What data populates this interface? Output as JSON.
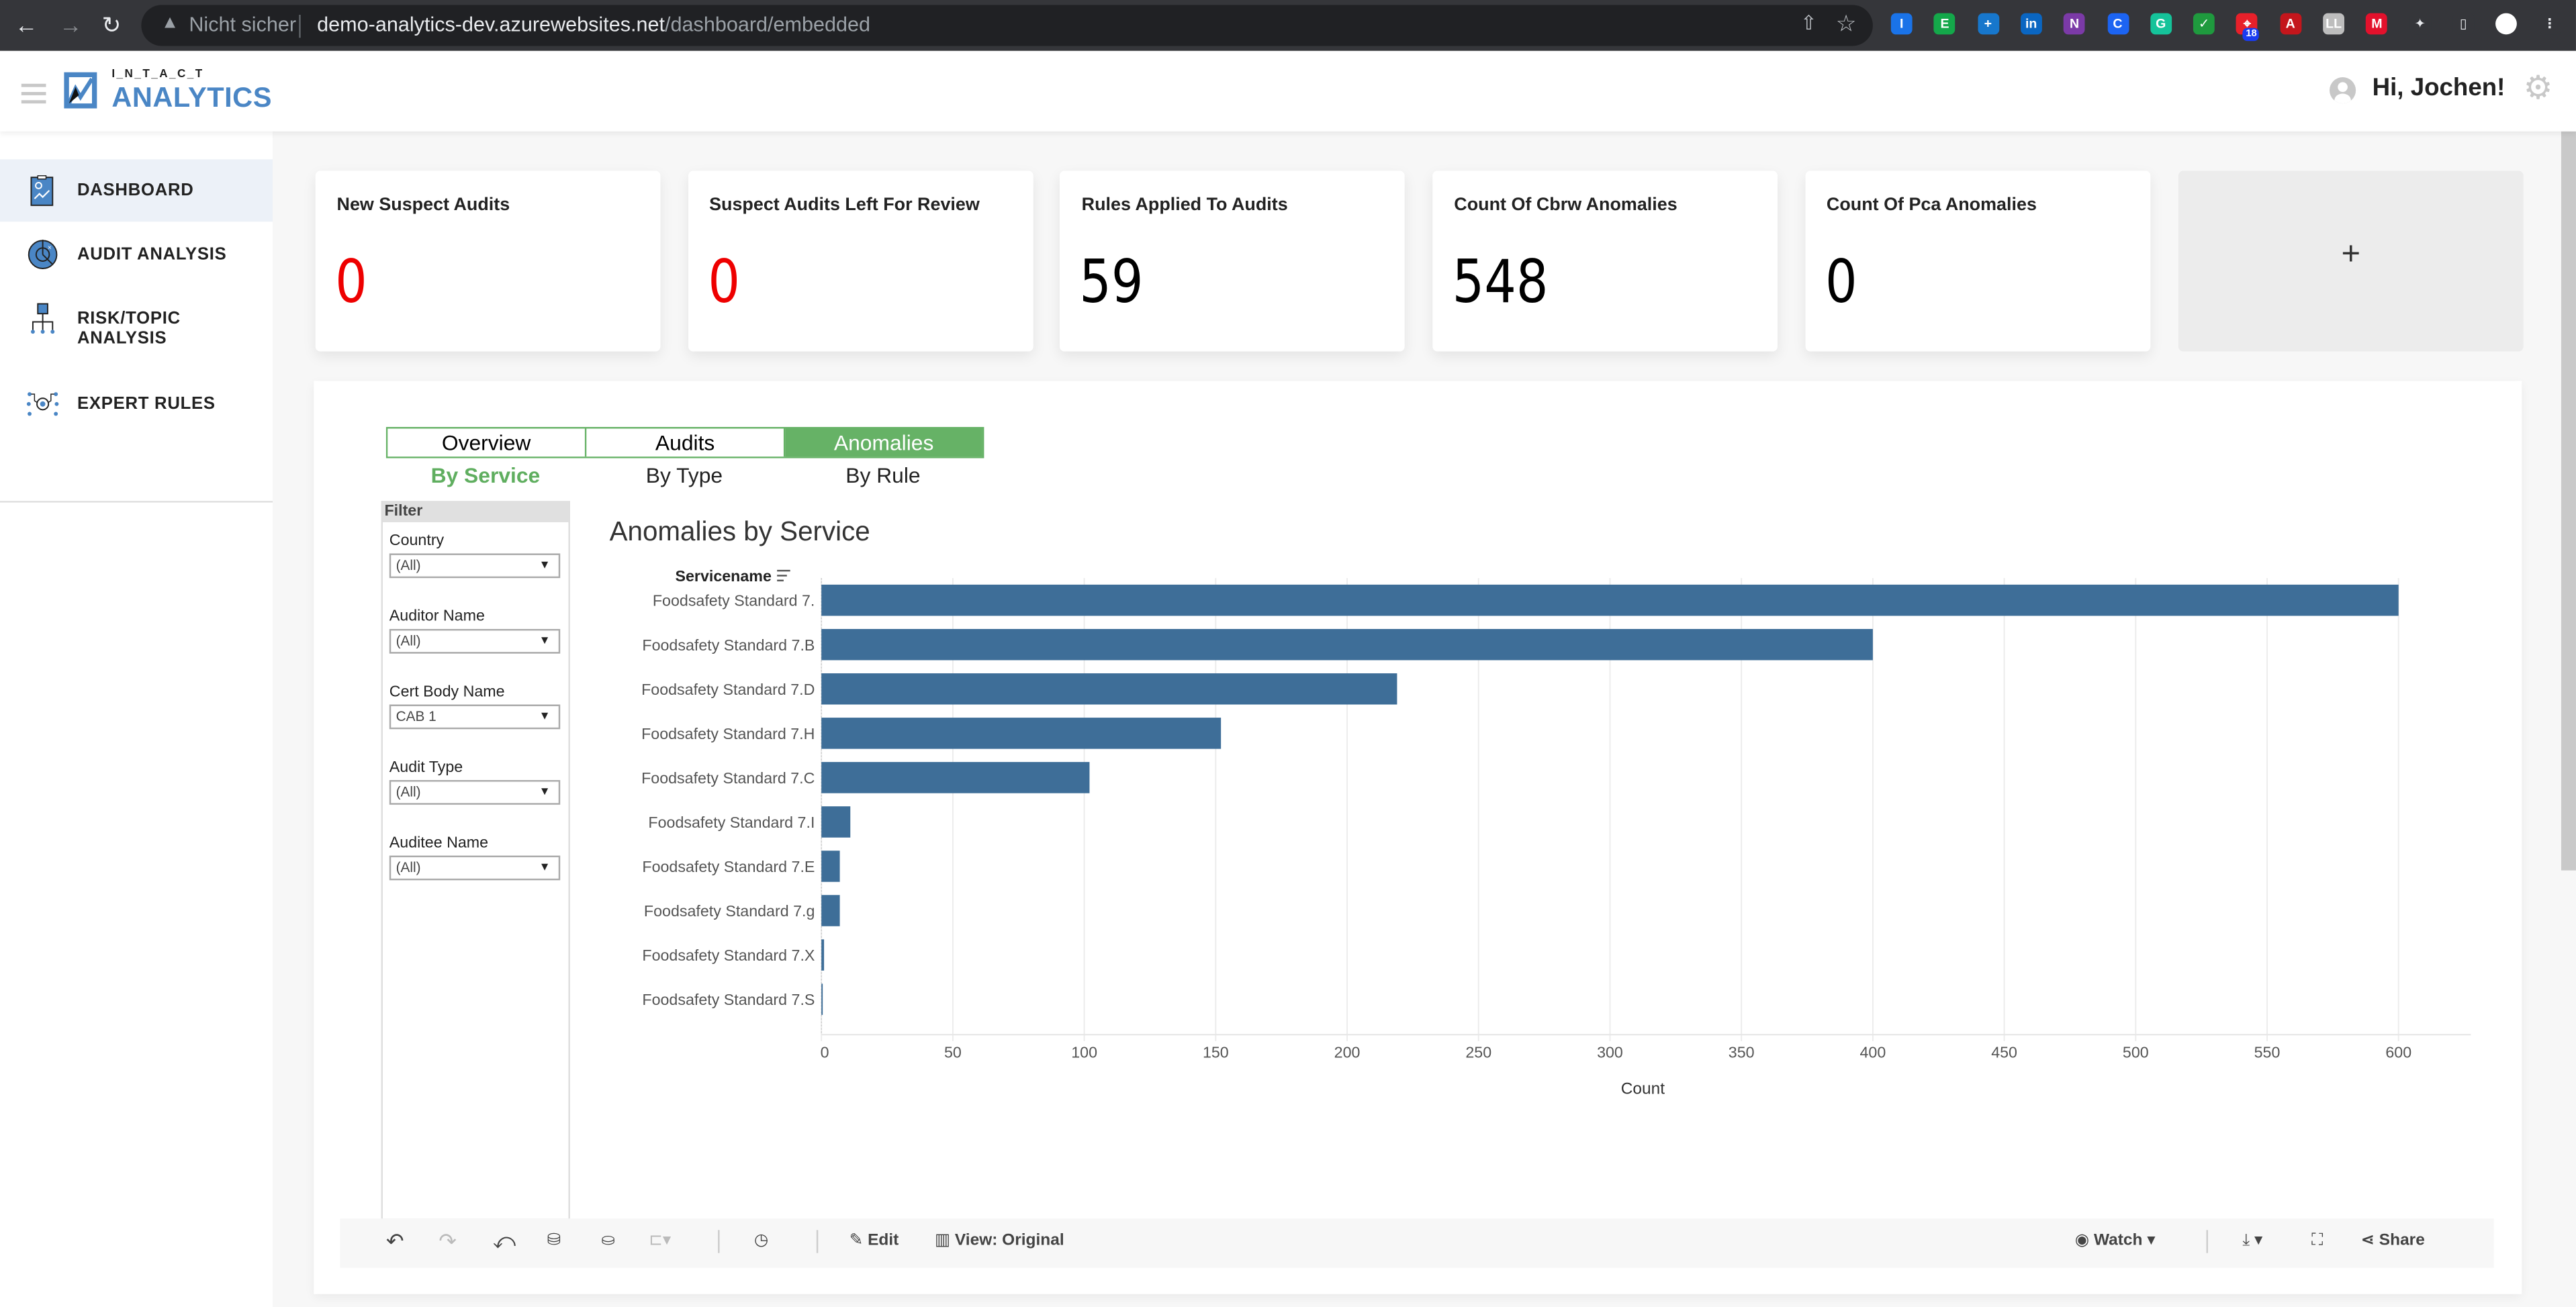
{
  "browser": {
    "security_label": "Nicht sicher",
    "url_host": "demo-analytics-dev.azurewebsites.net",
    "url_path": "/dashboard/embedded",
    "extensions": [
      {
        "name": "1password-extension-icon",
        "color": "#1a73e8",
        "glyph": "I"
      },
      {
        "name": "evernote-extension-icon",
        "color": "#14a84a",
        "glyph": "E"
      },
      {
        "name": "plus-extension-icon",
        "color": "#1777cc",
        "glyph": "+"
      },
      {
        "name": "linkedin-extension-icon",
        "color": "#0a66c2",
        "glyph": "in"
      },
      {
        "name": "onenote-extension-icon",
        "color": "#7b3aa7",
        "glyph": "N"
      },
      {
        "name": "c-extension-icon",
        "color": "#1c64f2",
        "glyph": "C"
      },
      {
        "name": "grammarly-extension-icon",
        "color": "#15c39a",
        "glyph": "G"
      },
      {
        "name": "check-extension-icon",
        "color": "#1f9a3e",
        "glyph": "✓"
      },
      {
        "name": "target-extension-icon",
        "color": "#e8202a",
        "glyph": "⌖",
        "badge": "18"
      },
      {
        "name": "acrobat-extension-icon",
        "color": "#c4161c",
        "glyph": "A"
      },
      {
        "name": "ll-extension-icon",
        "color": "#bdbdbd",
        "glyph": "LL"
      },
      {
        "name": "mendeley-extension-icon",
        "color": "#e3112c",
        "glyph": "M"
      },
      {
        "name": "extensions-puzzle-icon",
        "color": "#35363a",
        "glyph": "✦"
      },
      {
        "name": "sidepanel-icon",
        "color": "#35363a",
        "glyph": "▯"
      },
      {
        "name": "profile-avatar-icon",
        "color": "#ffffff",
        "glyph": ""
      },
      {
        "name": "browser-menu-icon",
        "color": "#35363a",
        "glyph": "⋮"
      }
    ]
  },
  "header": {
    "logo_top": "I_N_T_A_C_T",
    "logo_main": "ANALYTICS",
    "greeting": "Hi, Jochen!"
  },
  "sidebar": {
    "items": [
      {
        "label": "DASHBOARD",
        "active": true
      },
      {
        "label": "AUDIT ANALYSIS",
        "active": false
      },
      {
        "label": "RISK/TOPIC ANALYSIS",
        "active": false
      },
      {
        "label": "EXPERT RULES",
        "active": false
      }
    ]
  },
  "kpis": [
    {
      "title": "New Suspect Audits",
      "value": "0",
      "color": "#ee0000"
    },
    {
      "title": "Suspect Audits Left For Review",
      "value": "0",
      "color": "#ee0000"
    },
    {
      "title": "Rules Applied To Audits",
      "value": "59",
      "color": "#000000"
    },
    {
      "title": "Count Of Cbrw Anomalies",
      "value": "548",
      "color": "#000000"
    },
    {
      "title": "Count Of Pca Anomalies",
      "value": "0",
      "color": "#000000"
    }
  ],
  "add_kpi_label": "+",
  "viz": {
    "tabs": [
      {
        "label": "Overview",
        "active": false
      },
      {
        "label": "Audits",
        "active": false
      },
      {
        "label": "Anomalies",
        "active": true
      }
    ],
    "subtabs": [
      {
        "label": "By Service",
        "active": true
      },
      {
        "label": "By Type",
        "active": false
      },
      {
        "label": "By Rule",
        "active": false
      }
    ],
    "filter": {
      "heading": "Filter",
      "groups": [
        {
          "label": "Country",
          "value": "(All)"
        },
        {
          "label": "Auditor Name",
          "value": "(All)"
        },
        {
          "label": "Cert Body Name",
          "value": "CAB 1"
        },
        {
          "label": "Audit Type",
          "value": "(All)"
        },
        {
          "label": "Auditee Name",
          "value": "(All)"
        }
      ]
    },
    "axis_header": "Servicename",
    "accent_color": "#66b266",
    "bar_color": "#3e6e98"
  },
  "chart_data": {
    "type": "bar",
    "orientation": "horizontal",
    "title": "Anomalies by Service",
    "ylabel": "Servicename",
    "xlabel": "Count",
    "categories": [
      "Foodsafety Standard 7.",
      "Foodsafety Standard 7.B",
      "Foodsafety Standard 7.D",
      "Foodsafety Standard 7.H",
      "Foodsafety Standard 7.C",
      "Foodsafety Standard 7.I",
      "Foodsafety Standard 7.E",
      "Foodsafety Standard 7.g",
      "Foodsafety Standard 7.X",
      "Foodsafety Standard 7.S"
    ],
    "values": [
      600,
      400,
      219,
      152,
      102,
      11,
      7,
      7,
      1,
      0.5
    ],
    "xlim": [
      0,
      620
    ],
    "xticks": [
      0,
      50,
      100,
      150,
      200,
      250,
      300,
      350,
      400,
      450,
      500,
      550,
      600
    ],
    "grid": true,
    "legend": "none"
  },
  "toolbar": {
    "edit_label": "Edit",
    "view_label": "View: Original",
    "watch_label": "Watch",
    "share_label": "Share"
  }
}
